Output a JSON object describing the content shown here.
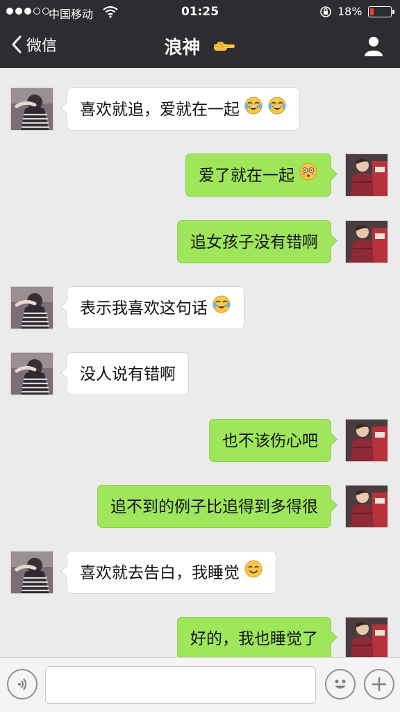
{
  "status_bar": {
    "carrier": "中国移动",
    "time": "01:25",
    "battery_percent": "18%",
    "battery_level": 0.18,
    "signal_bars": 3
  },
  "nav": {
    "back_label": "微信",
    "title": "浪神",
    "title_icon": "pointing-hand-icon",
    "right_icon": "person-icon"
  },
  "messages": [
    {
      "side": "left",
      "text": "喜欢就追，爱就在一起",
      "emojis": [
        "laughing-crying-emoji",
        "laughing-crying-emoji"
      ]
    },
    {
      "side": "right",
      "text": "爱了就在一起",
      "emojis": [
        "flushed-emoji"
      ]
    },
    {
      "side": "right",
      "text": "追女孩子没有错啊",
      "emojis": []
    },
    {
      "side": "left",
      "text": "表示我喜欢这句话",
      "emojis": [
        "laughing-crying-emoji"
      ]
    },
    {
      "side": "left",
      "text": "没人说有错啊",
      "emojis": []
    },
    {
      "side": "right",
      "text": "也不该伤心吧",
      "emojis": []
    },
    {
      "side": "right",
      "text": "追不到的例子比追得到多得很",
      "emojis": []
    },
    {
      "side": "left",
      "text": "喜欢就去告白，我睡觉",
      "emojis": [
        "smiling-emoji"
      ]
    },
    {
      "side": "right",
      "text": "好的，我也睡觉了",
      "emojis": []
    }
  ],
  "input_bar": {
    "voice_icon": "voice-icon",
    "text_value": "",
    "emoji_icon": "emoji-icon",
    "plus_icon": "plus-icon"
  },
  "colors": {
    "chrome_bg": "#2d2d31",
    "chat_bg": "#ebebeb",
    "sent_bubble": "#9fe65b",
    "received_bubble": "#ffffff",
    "battery_low": "#ff3b30"
  }
}
